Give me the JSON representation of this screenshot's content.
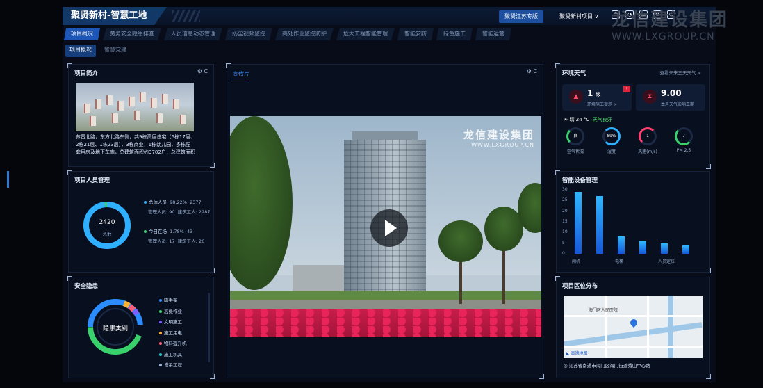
{
  "app": {
    "title": "聚贤新村-智慧工地"
  },
  "topbar": {
    "project_button": "聚贤江苏专版",
    "project_select": "聚贤新村项目 ∨",
    "icons": [
      "user-icon",
      "bell-icon",
      "screen-icon",
      "settings-icon",
      "power-icon"
    ]
  },
  "nav": {
    "tabs": [
      "项目概况",
      "劳务安全隐患排查",
      "人员信息动态管理",
      "扬尘视频监控",
      "高处作业监控防护",
      "危大工程智能管理",
      "智能安防",
      "绿色施工",
      "智能运营"
    ],
    "active": 0
  },
  "subnav": {
    "tabs": [
      "项目概况",
      "智慧党建"
    ],
    "active": 0
  },
  "project_intro": {
    "title": "项目简介",
    "controls": "⚙ C",
    "text": "苏晋北路，东方北路东侧，共9栋高层住宅（6栋17层、2栋21层、1栋23层），3栋商业，1栋幼儿园，多栋配套用房及地下车库，总建筑面积约3702户，总建筑面积"
  },
  "personnel": {
    "title": "项目人员管理",
    "total_value": "2420",
    "total_label": "总数",
    "group1": {
      "label": "总体人员",
      "pct": "98.22%",
      "count": "2377",
      "mgr": "管理人员: 90",
      "worker_label": "建筑工人: 2287"
    },
    "group2": {
      "label": "今日在场",
      "pct": "1.78%",
      "count": "43",
      "mgr": "管理人员: 17",
      "worker_label": "建筑工人: 26"
    }
  },
  "hazard": {
    "title": "安全隐患",
    "center_label": "隐患类别",
    "items": [
      "脚手架",
      "高处作业",
      "文明施工",
      "施工用电",
      "物料提升机",
      "施工机具",
      "塔吊工程"
    ],
    "colors": [
      "#2b8cff",
      "#39d16c",
      "#7c5cff",
      "#ffb02e",
      "#ff5c7a",
      "#20c7c7",
      "#9fb6d8"
    ]
  },
  "video": {
    "tab": "宣传片",
    "controls": "⚙ C",
    "watermark": "龙信建设集团",
    "watermark_url": "WWW.LXGROUP.CN"
  },
  "environment": {
    "title": "环境天气",
    "link": "查看未来三天天气 >",
    "card1": {
      "value": "1",
      "unit": "级",
      "sub": "环境施工提示 >",
      "badge": "!"
    },
    "card2": {
      "value": "9.00",
      "sub": "本月天气影响工期"
    },
    "weather": "晴  24 °C",
    "weather_status": "天气良好",
    "gauges": [
      {
        "value": "良",
        "label": "空气状况"
      },
      {
        "value": "89%",
        "label": "湿度"
      },
      {
        "value": "1",
        "label": "风速(m/s)"
      },
      {
        "value": "7",
        "label": "PM 2.5"
      }
    ]
  },
  "devices": {
    "title": "智能设备管理",
    "chart_data": {
      "type": "bar",
      "categories": [
        "闸机",
        "",
        "电梯",
        "",
        "人员定位",
        ""
      ],
      "values": [
        29,
        27,
        8,
        6,
        5,
        4
      ],
      "ylim": [
        0,
        30
      ],
      "yticks": [
        0,
        5,
        10,
        15,
        20,
        25,
        30
      ]
    }
  },
  "location": {
    "title": "项目区位分布",
    "map_label": "海门区人民医院",
    "map_logo": "◣ 高德地图",
    "address": "◎ 江苏省南通市海门区海门街道秀山中心路"
  },
  "brand_watermark": {
    "name": "龙信建设集团",
    "url": "WWW.LXGROUP.CN"
  }
}
